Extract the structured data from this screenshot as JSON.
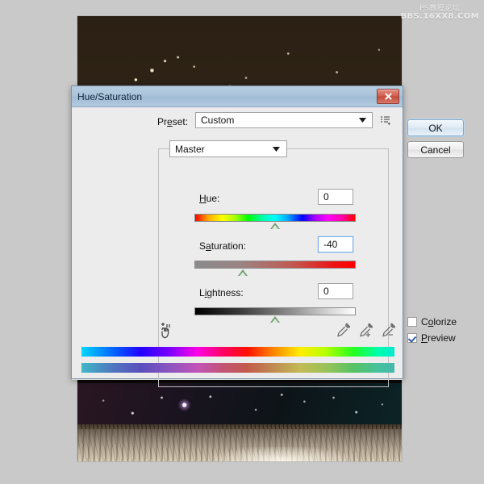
{
  "watermark": {
    "line1": "PS教程论坛",
    "line2": "BBS.16XX8.COM"
  },
  "dialog": {
    "title": "Hue/Saturation",
    "close_label": "x",
    "preset": {
      "label": "Preset:",
      "value": "Custom",
      "menu_icon": "preset-list-icon"
    },
    "buttons": {
      "ok": "OK",
      "cancel": "Cancel"
    },
    "channel": {
      "value": "Master"
    },
    "sliders": [
      {
        "name": "hue",
        "label": "Hue:",
        "value": "0",
        "thumb_percent": 50
      },
      {
        "name": "saturation",
        "label": "Saturation:",
        "value": "-40",
        "thumb_percent": 30
      },
      {
        "name": "lightness",
        "label": "Lightness:",
        "value": "0",
        "thumb_percent": 50
      }
    ],
    "tools": {
      "targeted_adjustment": "targeted-adjustment-hand-icon",
      "eyedropper": "eyedropper-icon",
      "eyedropper_add": "eyedropper-plus-icon",
      "eyedropper_subtract": "eyedropper-minus-icon"
    },
    "checkboxes": {
      "colorize": {
        "label": "Colorize",
        "checked": false
      },
      "preview": {
        "label": "Preview",
        "checked": true
      }
    }
  },
  "colors": {
    "titlebar": "#a9c3da",
    "dialog_bg": "#ececec",
    "accent_blue": "#7fa8c8",
    "close_red": "#c14e3c",
    "thumb_green": "#6f9b74"
  }
}
